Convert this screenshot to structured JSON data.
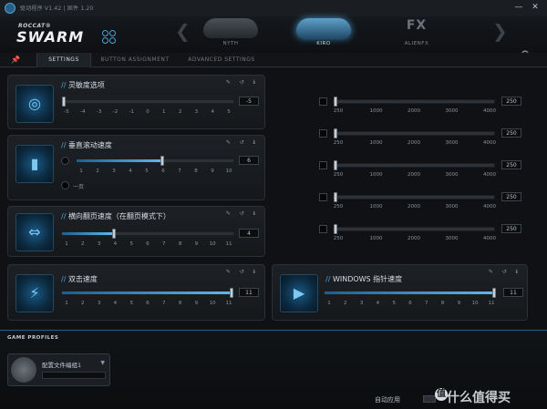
{
  "window": {
    "title": "驱动程序 V1.42 | 固件 1.20",
    "minimize": "—",
    "close": "✕"
  },
  "brand": {
    "top": "ROCCAT®",
    "main": "SWARM"
  },
  "devices": [
    {
      "label": "NYTH",
      "active": false
    },
    {
      "label": "KIRO",
      "active": true
    },
    {
      "label": "ALIENFX",
      "text": "FX",
      "active": false
    }
  ],
  "nav": {
    "prev": "❮",
    "next": "❯"
  },
  "tabs": [
    {
      "label": "SETTINGS",
      "active": true
    },
    {
      "label": "BUTTON ASSIGNMENT",
      "active": false
    },
    {
      "label": "ADVANCED SETTINGS",
      "active": false
    }
  ],
  "panels": {
    "sensitivity": {
      "title": "灵敏度选项",
      "ticks": [
        "-5",
        "-4",
        "-3",
        "-2",
        "-1",
        "0",
        "1",
        "2",
        "3",
        "4",
        "5"
      ],
      "value": "-5",
      "level": 0.0
    },
    "vscroll": {
      "title": "垂直滚动速度",
      "ticks": [
        "1",
        "2",
        "3",
        "4",
        "5",
        "6",
        "7",
        "8",
        "9",
        "10"
      ],
      "value": "6",
      "level": 0.55,
      "page_option": "一页"
    },
    "hscroll": {
      "title": "横向翻页速度（在翻页模式下）",
      "ticks": [
        "1",
        "2",
        "3",
        "4",
        "5",
        "6",
        "7",
        "8",
        "9",
        "10",
        "11"
      ],
      "value": "4",
      "level": 0.3
    },
    "dblclick": {
      "title": "双击速度",
      "ticks": [
        "1",
        "2",
        "3",
        "4",
        "5",
        "6",
        "7",
        "8",
        "9",
        "10",
        "11"
      ],
      "value": "11",
      "level": 1.0
    },
    "pointer": {
      "title": "WINDOWS 指针速度",
      "ticks": [
        "1",
        "2",
        "3",
        "4",
        "5",
        "6",
        "7",
        "8",
        "9",
        "10",
        "11"
      ],
      "value": "11",
      "level": 1.0
    }
  },
  "dpi_rows": [
    {
      "ticks": [
        "250",
        "1000",
        "2000",
        "3000",
        "4000"
      ],
      "value": "250"
    },
    {
      "ticks": [
        "250",
        "1000",
        "2000",
        "3000",
        "4000"
      ],
      "value": "250"
    },
    {
      "ticks": [
        "250",
        "1000",
        "2000",
        "3000",
        "4000"
      ],
      "value": "250"
    },
    {
      "ticks": [
        "250",
        "1000",
        "2000",
        "3000",
        "4000"
      ],
      "value": "250"
    },
    {
      "ticks": [
        "250",
        "1000",
        "2000",
        "3000",
        "4000"
      ],
      "value": "250"
    }
  ],
  "panel_icons": "✎ ↺ ℹ",
  "profiles": {
    "title": "GAME PROFILES",
    "name": "配置文件编组1",
    "auto_apply": "自动应用"
  },
  "watermark": "什么值得买",
  "watermark_badge": "值",
  "icons": {
    "gear": "⚙",
    "pin": "📌",
    "down": "⌄"
  },
  "colors": {
    "accent": "#4da3d8",
    "background": "#0d0f12",
    "panel": "#1d2125"
  }
}
